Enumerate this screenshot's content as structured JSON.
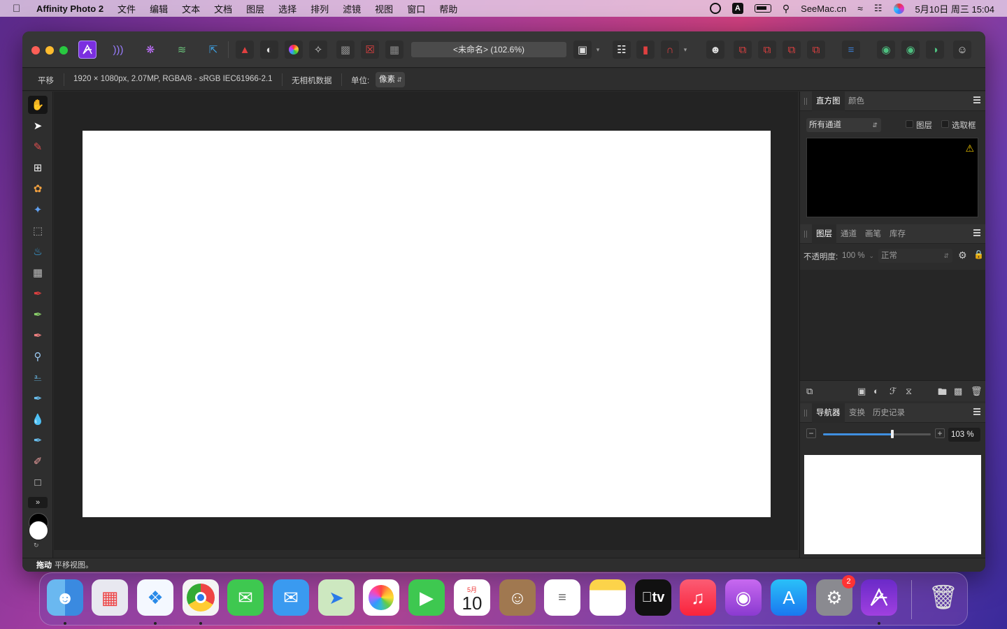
{
  "menubar": {
    "app_name": "Affinity Photo 2",
    "menus": [
      "文件",
      "编辑",
      "文本",
      "文档",
      "图层",
      "选择",
      "排列",
      "滤镜",
      "视图",
      "窗口",
      "帮助"
    ],
    "site_label": "SeeMac.cn",
    "datetime": "5月10日 周三  15:04",
    "input_badge": "A"
  },
  "toolbar": {
    "document_title": "<未命名> (102.6%)"
  },
  "context_toolbar": {
    "tool_name": "平移",
    "document_info": "1920 × 1080px, 2.07MP, RGBA/8 - sRGB IEC61966-2.1",
    "camera_data": "无相机数据",
    "unit_label": "单位:",
    "unit_value": "像素"
  },
  "panels": {
    "histogram": {
      "tabs": [
        "直方图",
        "颜色"
      ],
      "channel_select": "所有通道",
      "layer_checkbox": "图层",
      "marquee_checkbox": "选取框"
    },
    "layers": {
      "tabs": [
        "图层",
        "通道",
        "画笔",
        "库存"
      ],
      "opacity_label": "不透明度:",
      "opacity_value": "100 %",
      "blend_mode": "正常"
    },
    "navigator": {
      "tabs": [
        "导航器",
        "变换",
        "历史记录"
      ],
      "zoom_value": "103 %",
      "zoom_slider_fraction": 0.64
    }
  },
  "status": {
    "bold_label": "拖动",
    "message": "平移视图。"
  },
  "dock": {
    "calendar_month": "5月",
    "calendar_day": "10",
    "settings_badge": "2",
    "tv_label": "tv"
  },
  "colors": {
    "accent": "#3f8fe0",
    "canvas_bg": "#232323",
    "close": "#fe5f57",
    "minimize": "#febc2e",
    "zoom": "#28c840"
  }
}
